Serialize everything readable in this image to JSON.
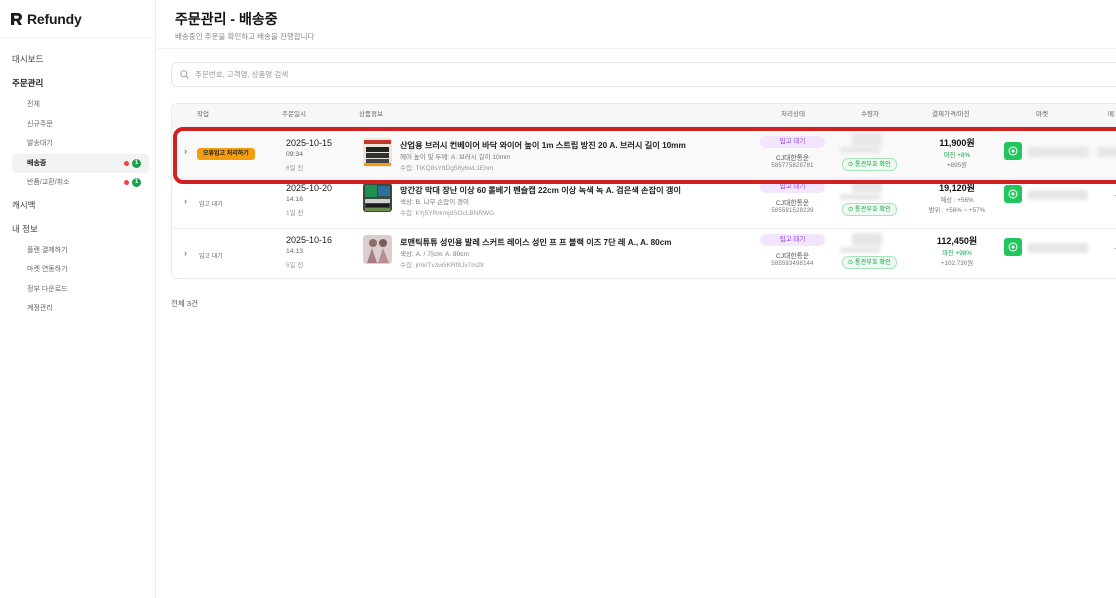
{
  "app": {
    "name": "Refundy"
  },
  "sidebar": {
    "items": [
      {
        "label": "대시보드"
      },
      {
        "label": "주문관리"
      },
      {
        "label": "전체"
      },
      {
        "label": "신규주문"
      },
      {
        "label": "발송대기"
      },
      {
        "label": "배송중"
      },
      {
        "label": "반품/교환/취소"
      },
      {
        "label": "캐시백"
      },
      {
        "label": "내 정보"
      },
      {
        "label": "플랜 결제하기"
      },
      {
        "label": "마켓 연동하기"
      },
      {
        "label": "정부 다운로드"
      },
      {
        "label": "계정관리"
      }
    ],
    "badge_count": "1"
  },
  "page": {
    "title": "주문관리 - 배송중",
    "subtitle": "배송중인 주문을 확인하고 배송을 진행합니다"
  },
  "search": {
    "placeholder": "주문번호, 고객명, 상품명 검색"
  },
  "table": {
    "headers": [
      "작업",
      "주문일시",
      "상품정보",
      "처리상태",
      "수령자",
      "결제가격/마진",
      "마켓",
      "메"
    ],
    "rows": [
      {
        "action": "오류입고 처리하기",
        "date": "2025-10-15",
        "time": "09:34",
        "ago": "6일 전",
        "title": "산업용 브러시 컨베이어 바닥 와이어 높이 1m 스트립 방진 20 A. 브러시 길이 10mm",
        "option": "헤어 높이 및 두께: A. 브러시 길이 10mm",
        "code": "수집: TIKQ8sY8Dg58y6wL1Ehm",
        "status": "입고 대기",
        "carrier": "CJ대한통운",
        "tracking": "585775828781",
        "customs": "통관부호 확인",
        "price": "11,900원",
        "margin_line1": "마진 +8%",
        "margin_line2": "+895원",
        "dash": "-"
      },
      {
        "action": "입고 대기",
        "date": "2025-10-20",
        "time": "14:16",
        "ago": "1일 전",
        "title": "망간강 막대 장난 이상 60 롤베기 펜슬캡 22cm 이상 녹색 녹 A. 검은색 손잡이 갱이",
        "option": "색상: B. 나무 손잡이 갱이",
        "code": "수집: kYj5YRrkmjdSOcLBNRWG",
        "status": "입고 대기",
        "carrier": "CJ대한통운",
        "tracking": "585591528239",
        "customs": "통관부호 확인",
        "price": "19,120원",
        "margin_line1": "예상 : +56%",
        "margin_line2": "범위 : +56% ~ +57%",
        "dash": "-"
      },
      {
        "action": "입고 대기",
        "date": "2025-10-16",
        "time": "14:13",
        "ago": "5일 전",
        "title": "로맨틱튜튜 성인용 발레 스커트 레이스 성인 프 프 블랙 이즈 7단 레 A., A. 80cm",
        "option": "색상: A. / 기cm: A. 80cm",
        "code": "수집: jmk/Tv3w5KRf8Jv7m2fr",
        "status": "입고 대기",
        "carrier": "CJ대한통운",
        "tracking": "585593498144",
        "customs": "통관부호 확인",
        "price": "112,450원",
        "margin_line1": "마진 +98%",
        "margin_line2": "+102,730원",
        "dash": "-"
      }
    ],
    "total": "전체 3건"
  },
  "colors": {
    "highlight": "#d0201f",
    "accent_orange": "#f59e0b",
    "badge_purple": "#8a3fe0",
    "success_green": "#16a34a"
  }
}
